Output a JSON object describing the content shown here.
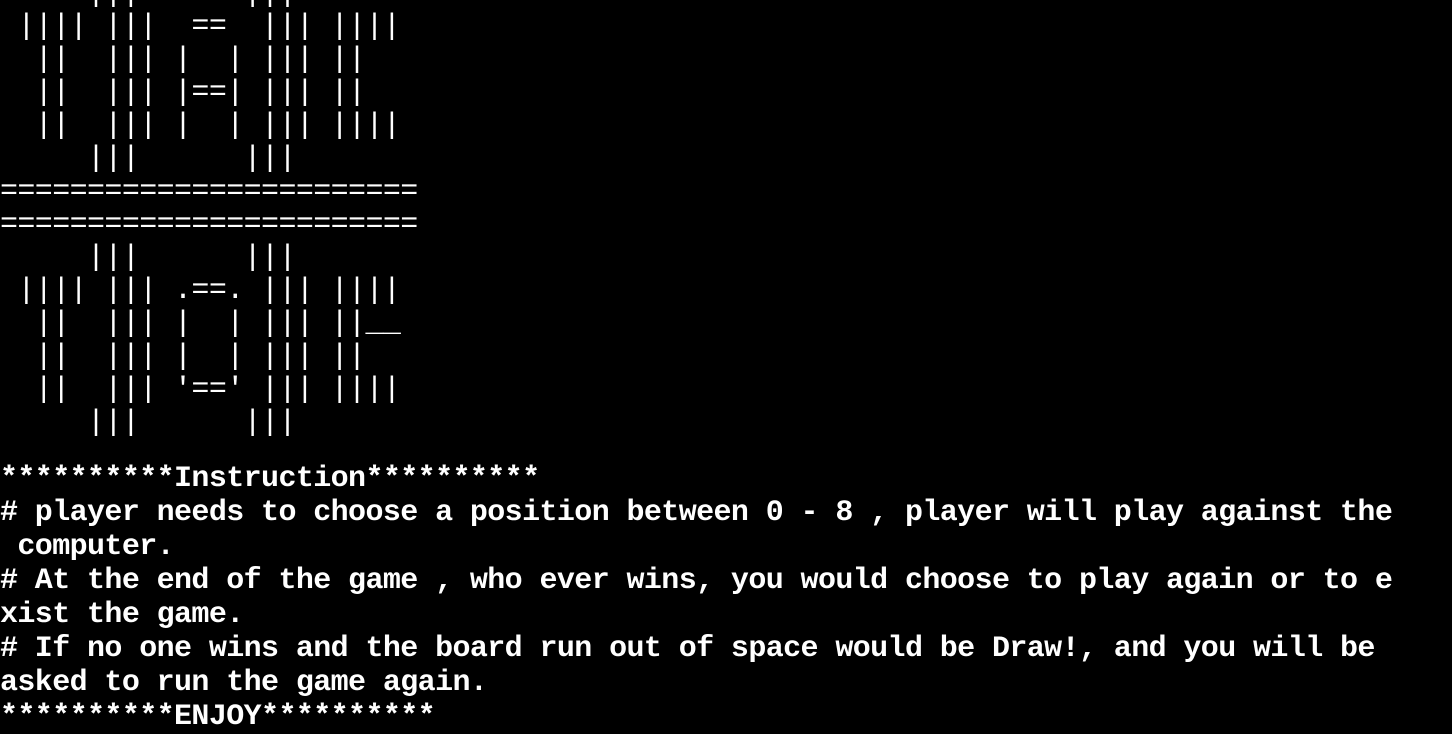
{
  "banner": {
    "lines": [
      "     |||      |||",
      " |||| |||  ==  ||| ||||",
      "  ||  ||| |  | ||| ||",
      "  ||  ||| |==| ||| ||",
      "  ||  ||| |  | ||| ||||",
      "     |||      |||",
      "========================",
      "========================",
      "     |||      |||",
      " |||| ||| .==. ||| ||||",
      "  ||  ||| |  | ||| ||__",
      "  ||  ||| |  | ||| ||",
      "  ||  ||| '==' ||| ||||",
      "     |||      |||"
    ]
  },
  "instructions": {
    "header": "**********Instruction**********",
    "lines": [
      "# player needs to choose a position between 0 - 8 , player will play against the",
      " computer.",
      "# At the end of the game , who ever wins, you would choose to play again or to e",
      "xist the game.",
      "# If no one wins and the board run out of space would be Draw!, and you will be",
      "asked to run the game again."
    ],
    "footer": "**********ENJOY**********"
  },
  "colors": {
    "background": "#000000",
    "text": "#ffffff"
  }
}
